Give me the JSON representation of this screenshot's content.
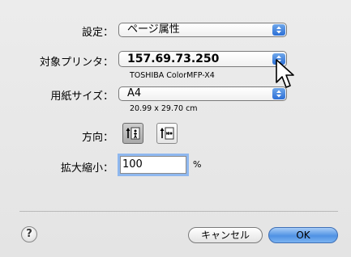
{
  "settings": {
    "label": "設定：",
    "value": "ページ属性"
  },
  "printer": {
    "label": "対象プリンタ：",
    "value": "157.69.73.250",
    "description": "TOSHIBA ColorMFP-X4"
  },
  "paper": {
    "label": "用紙サイズ：",
    "value": "A4",
    "dimensions": "20.99 x 29.70 cm"
  },
  "orientation": {
    "label": "方向：",
    "options": [
      "portrait",
      "landscape"
    ],
    "selected": "portrait"
  },
  "scale": {
    "label": "拡大縮小：",
    "value": "100",
    "unit": "%"
  },
  "footer": {
    "help_label": "?",
    "cancel_label": "キャンセル",
    "ok_label": "OK"
  },
  "colors": {
    "accent": "#3b7fe0",
    "background": "#e8e8e8",
    "focus_ring": "#8fb8ef"
  }
}
